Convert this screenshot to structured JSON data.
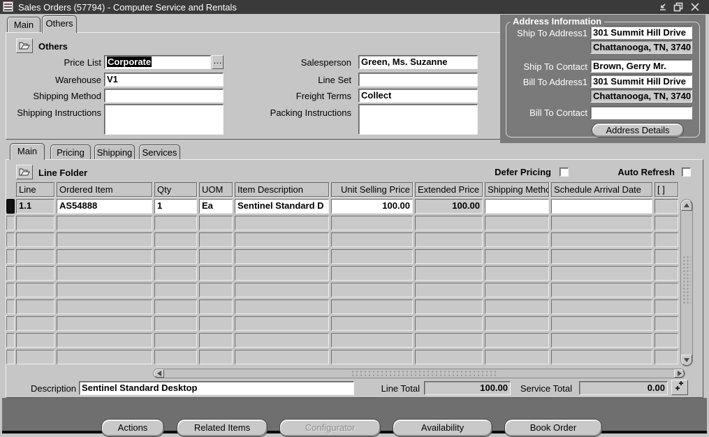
{
  "window": {
    "title": "Sales Orders (57794) - Computer Service and Rentals",
    "controls": {
      "minimize": "minimize-icon",
      "restore": "restore-icon",
      "close": "close-icon"
    }
  },
  "colors": {
    "canvas": "#c6c6c6",
    "titlebar": "#3a3a3a",
    "address_panel": "#7a7a7a",
    "mdi_background": "#6f6f6f",
    "selection_bg": "#000000",
    "selection_fg": "#ffffff"
  },
  "icons": {
    "app": "oracle-logo",
    "folder": "open-folder",
    "lov": "…",
    "expand": "plus-plus"
  },
  "top_tabs": [
    {
      "label": "Main",
      "active": false
    },
    {
      "label": "Others",
      "active": true
    }
  ],
  "others_section": {
    "header": "Others",
    "price_list": {
      "label": "Price List",
      "value": "Corporate",
      "selected": true,
      "lov_button": "…"
    },
    "warehouse": {
      "label": "Warehouse",
      "value": "V1"
    },
    "shipping_method": {
      "label": "Shipping Method",
      "value": ""
    },
    "shipping_instructions": {
      "label": "Shipping Instructions",
      "value": ""
    },
    "salesperson": {
      "label": "Salesperson",
      "value": "Green, Ms. Suzanne"
    },
    "line_set": {
      "label": "Line Set",
      "value": ""
    },
    "freight_terms": {
      "label": "Freight Terms",
      "value": "Collect"
    },
    "packing_instructions": {
      "label": "Packing Instructions",
      "value": ""
    }
  },
  "address_info": {
    "title": "Address Information",
    "ship_to_address1_label": "Ship To Address1",
    "ship_to_address1": "301 Summit Hill Drive",
    "ship_to_address2": "Chattanooga, TN, 3740",
    "ship_to_contact_label": "Ship To Contact",
    "ship_to_contact": "Brown, Gerry Mr.",
    "bill_to_address1_label": "Bill To Address1",
    "bill_to_address1": "301 Summit Hill Drive",
    "bill_to_address2": "Chattanooga, TN, 3740",
    "bill_to_contact_label": "Bill To Contact",
    "bill_to_contact": "",
    "address_details_button": "Address Details"
  },
  "line_tabs": [
    {
      "label": "Main",
      "active": true
    },
    {
      "label": "Pricing",
      "active": false
    },
    {
      "label": "Shipping",
      "active": false
    },
    {
      "label": "Services",
      "active": false
    }
  ],
  "lines_section": {
    "header": "Line Folder",
    "defer_pricing": {
      "label": "Defer Pricing",
      "checked": false
    },
    "auto_refresh": {
      "label": "Auto Refresh",
      "checked": false
    },
    "columns": [
      {
        "key": "line",
        "label": "Line"
      },
      {
        "key": "ordered_item",
        "label": "Ordered Item"
      },
      {
        "key": "qty",
        "label": "Qty"
      },
      {
        "key": "uom",
        "label": "UOM"
      },
      {
        "key": "item_description",
        "label": "Item Description"
      },
      {
        "key": "unit_selling_price",
        "label": "Unit Selling Price"
      },
      {
        "key": "extended_price",
        "label": "Extended Price"
      },
      {
        "key": "shipping_method",
        "label": "Shipping Method"
      },
      {
        "key": "schedule_arrival_date",
        "label": "Schedule Arrival Date"
      },
      {
        "key": "flag",
        "label": "[ ]"
      }
    ],
    "visible_row_slots": 10,
    "rows": [
      {
        "line": "1.1",
        "ordered_item": "AS54888",
        "qty": "1",
        "uom": "Ea",
        "item_description": "Sentinel Standard D",
        "unit_selling_price": "100.00",
        "extended_price": "100.00",
        "shipping_method": "",
        "schedule_arrival_date": "",
        "flag": ""
      }
    ]
  },
  "footer": {
    "description_label": "Description",
    "description": "Sentinel Standard Desktop",
    "line_total_label": "Line Total",
    "line_total": "100.00",
    "service_total_label": "Service Total",
    "service_total": "0.00"
  },
  "action_buttons": [
    {
      "label": "Actions",
      "enabled": true
    },
    {
      "label": "Related Items",
      "enabled": true
    },
    {
      "label": "Configurator",
      "enabled": false
    },
    {
      "label": "Availability",
      "enabled": true
    },
    {
      "label": "Book Order",
      "enabled": true
    }
  ]
}
